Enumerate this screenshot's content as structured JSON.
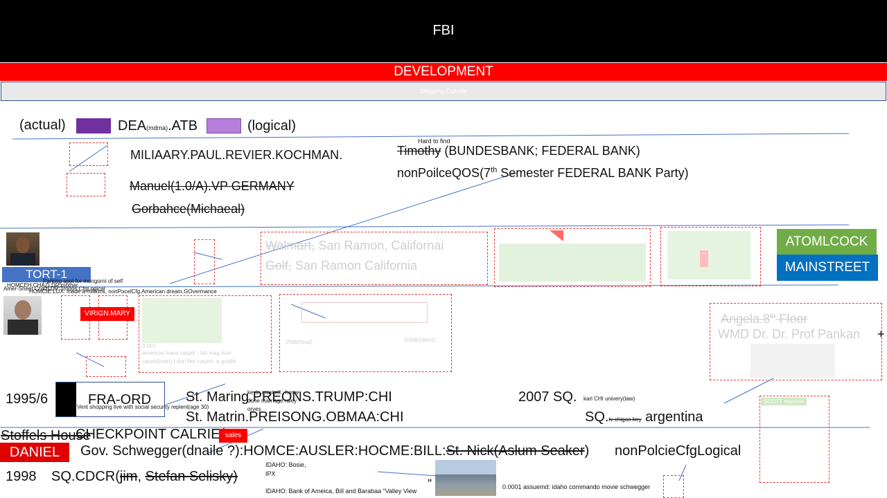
{
  "header": {
    "title": "FBI",
    "subtitle": "DEVELOPMENT",
    "caption": "Stepping Outside"
  },
  "legend": {
    "actual": "(actual)",
    "dea_main": "DEA",
    "dea_sub": "(mdma)",
    "dea_suffix": ".ATB",
    "logical": "(logical)",
    "actual_color": "#7030a0",
    "logical_color": "#b67fdc"
  },
  "section1": {
    "military": "MILIAARY.PAUL.REVIER.KOCHMAN.",
    "manuel": "Manuel(1.0/A).VP GERMANY",
    "gorbachev": "Gorbahce(Michaeal)",
    "hard_to_find": "Hard to find",
    "timothy": "Timothy",
    "bank": " (BUNDESBANK; FEDERAL BANK)",
    "nonpolice_pre": "nonPoilceQOS(7",
    "nonpolice_sup": "th",
    "nonpolice_post": " Semester FEDERAL BANK Party)"
  },
  "section2": {
    "walmart_strike": "Walmart,",
    "walmart_rest": " San Ramon, Californai",
    "golf_strike": "Golf,",
    "golf_rest": " San Ramon California",
    "atomlcock": "ATOMLCOCK",
    "mainstreet": "MAINSTREET",
    "atomlcock_color": "#70ad47",
    "mainstreet_color": "#0070c0"
  },
  "left": {
    "tort": "TORT-1",
    "homceh": "HOMCEH:CHAZLDR:mother",
    "mongorni": "Parking spot for mongorni of self",
    "amer": "Amer-Sheet:ChazLDR:Troops.CfgLogical",
    "homcie": "HOMCIE:LUX: made a millions, nonPocelCfg.American dream.GOvermance",
    "virign": "VIRIGN.MARY",
    "tort_color": "#4472c4",
    "virign_color": "#ff0000"
  },
  "section3": {
    "small_left": "0.001",
    "american": "american have carpet ; tsh mag itoin",
    "carpet": "carpet(train) I don like carpet; is gotdie",
    "loud": "-20db(loud)",
    "silent": "300db(silent)",
    "angela_pre": "Angela.8",
    "angela_sup": "th",
    "angela_post": " Floor",
    "wmd": "WMD Dr. Dr. Prof Pankan",
    "plus": "+",
    "scott": "SCOTT marunia"
  },
  "section4": {
    "year1": "1995/6",
    "fra": "FRA-ORD",
    "vent": "Vent shopping live with social security repient(age 30)",
    "kevin": "kevin maskell : home",
    "done": "done marriage raley",
    "oryes": "oryes",
    "st_maring": "St. Maring.PREONS.TRUMP:CHI",
    "st_matrin": "St. Matrin.PREISONG.OBMAA:CHI",
    "year2007": "2007 SQ.",
    "karl": "karl CHI univery(law)",
    "sq": "SQ.",
    "chigao": "tv chigao boy",
    "argentina": " argentina"
  },
  "section5": {
    "stoffels": "Stoffels House",
    "checkpoint": "CHECKPOINT CALRIE(",
    "sales": "sales",
    "daniel": "DANIEL",
    "gov_pre": "Gov. Schwegger(dnaile ?):HOMCE:AUSLER:HOCME:BILL:",
    "gov_strike": "St. Nick(Aslum Seaker",
    "gov_post": ")",
    "nonpolcie": "nonPolcieCfgLogical",
    "year1998": "1998",
    "sqcdcr": "SQ.CDCR(",
    "jim": "jim",
    "comma": ", ",
    "stefan": "Stefan Selisky)",
    "idaho1": "IDAHO: Bosie,",
    "ipx": "IPX",
    "idaho2": "IDAHO: Bank of Ameica, Bill and Barabaa “Valley View",
    "quote": "”",
    "assuemd": "0.0001 assuemd: idaho commando movie schwegger",
    "daniel_color": "#e00000",
    "sales_color": "#ff0000"
  }
}
